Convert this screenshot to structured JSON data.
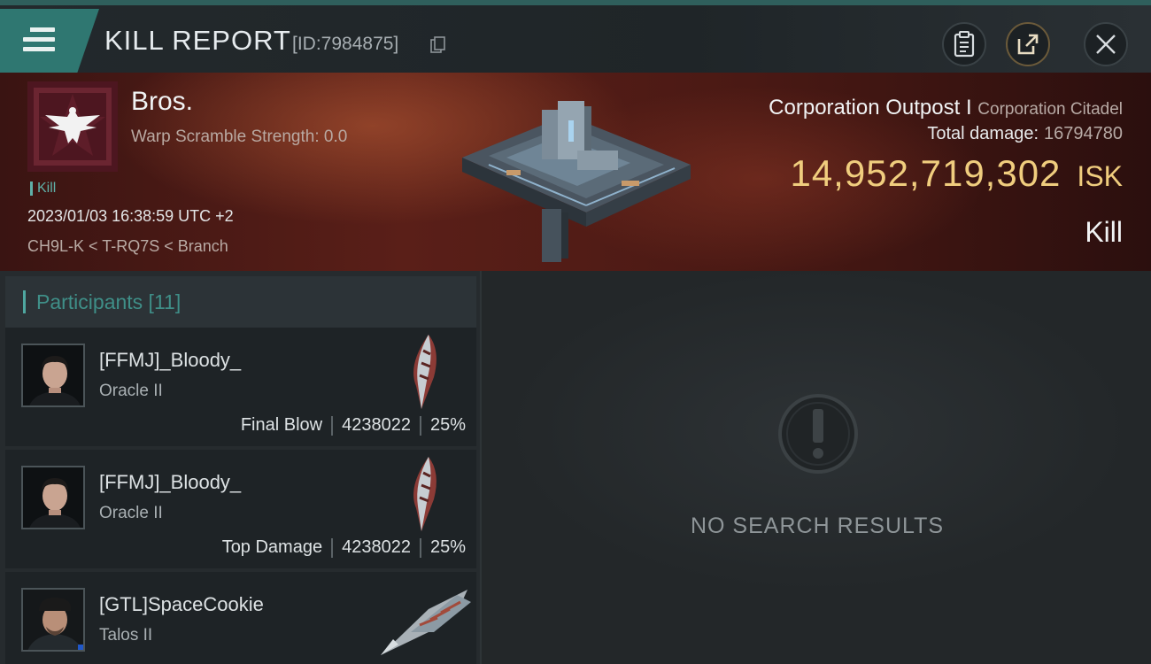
{
  "header": {
    "title": "KILL REPORT",
    "report_id": "[ID:7984875]"
  },
  "victim": {
    "name": "Bros.",
    "warp_scramble": "Warp Scramble Strength: 0.0",
    "kill_tag": "Kill",
    "timestamp": "2023/01/03 16:38:59 UTC +2",
    "location": "CH9L-K < T-RQ7S < Branch"
  },
  "target": {
    "name": "Corporation Outpost I",
    "class": "Corporation Citadel",
    "total_damage_label": "Total damage:",
    "total_damage": "16794780",
    "isk_value": "14,952,719,302",
    "isk_unit": "ISK",
    "result": "Kill"
  },
  "participants": {
    "header": "Participants [11]",
    "items": [
      {
        "name": "[FFMJ]_Bloody_",
        "ship": "Oracle II",
        "role": "Final Blow",
        "damage": "4238022",
        "percent": "25%"
      },
      {
        "name": "[FFMJ]_Bloody_",
        "ship": "Oracle II",
        "role": "Top Damage",
        "damage": "4238022",
        "percent": "25%"
      },
      {
        "name": "[GTL]SpaceCookie",
        "ship": "Talos II",
        "role": "",
        "damage": "",
        "percent": ""
      }
    ]
  },
  "right_panel": {
    "empty_message": "NO SEARCH RESULTS"
  },
  "colors": {
    "accent_teal": "#2f7771",
    "isk_gold": "#f0cd7e",
    "banner_red": "#5a1f18"
  },
  "icons": [
    "menu-icon",
    "copy-icon",
    "clipboard-icon",
    "share-icon",
    "close-icon",
    "warning-icon"
  ]
}
